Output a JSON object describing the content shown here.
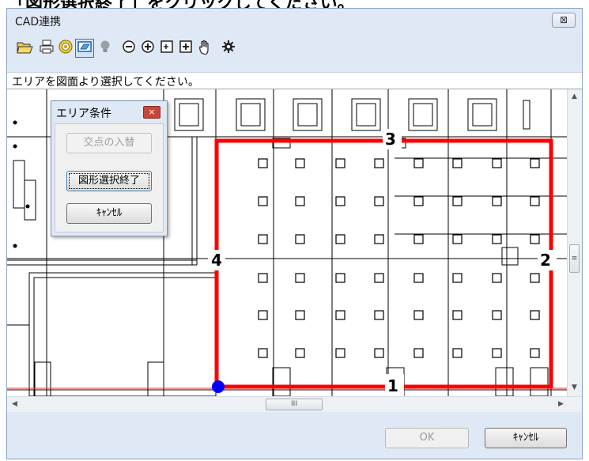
{
  "window": {
    "title": "CAD連携",
    "close_label": "⊠"
  },
  "top_strip_text": "「図形選択終了」をクリックしてください。",
  "toolbar": {
    "icons": [
      "folder-open-icon",
      "print-icon",
      "target-icon",
      "area-select-icon",
      "lightbulb-icon",
      "zoom-out-icon",
      "zoom-in-icon",
      "zoom-area-icon",
      "zoom-fit-icon",
      "pan-hand-icon",
      "settings-gear-icon"
    ]
  },
  "status_message": "エリアを図面より選択してください。",
  "dialog": {
    "title": "エリア条件",
    "close_label": "×",
    "swap_button": "交点の入替",
    "finish_button": "図形選択終了",
    "cancel_button": "ｷｬﾝｾﾙ"
  },
  "drawing": {
    "selection_color": "#ff0000",
    "vertex_color": "#0000ff",
    "edge_labels": [
      "1",
      "2",
      "3",
      "4"
    ]
  },
  "scrollbar": {
    "thumb_label": "III"
  },
  "footer": {
    "ok_button": "OK",
    "cancel_button": "ｷｬﾝｾﾙ"
  }
}
